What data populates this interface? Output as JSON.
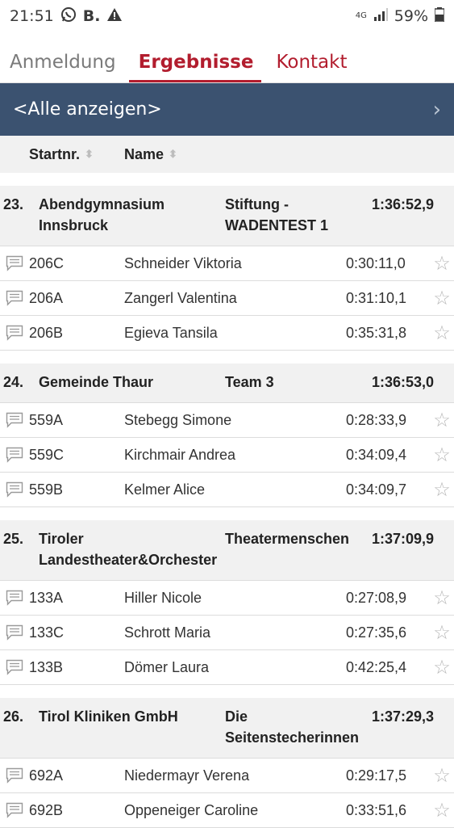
{
  "status": {
    "time": "21:51",
    "app_letter": "B.",
    "network": "4G",
    "battery": "59%"
  },
  "tabs": [
    {
      "label": "Anmeldung"
    },
    {
      "label": "Ergebnisse"
    },
    {
      "label": "Kontakt"
    }
  ],
  "filter": {
    "label": "<Alle anzeigen>",
    "chevron": "›"
  },
  "columns": {
    "startnr": "Startnr.",
    "name": "Name",
    "sort_icon": "⬍"
  },
  "teams": [
    {
      "rank": "23.",
      "name": "Abendgymnasium Innsbruck",
      "category": "Stiftung - WADENTEST 1",
      "time": "1:36:52,9",
      "members": [
        {
          "startnr": "206C",
          "name": "Schneider Viktoria",
          "time": "0:30:11,0"
        },
        {
          "startnr": "206A",
          "name": "Zangerl Valentina",
          "time": "0:31:10,1"
        },
        {
          "startnr": "206B",
          "name": "Egieva Tansila",
          "time": "0:35:31,8"
        }
      ]
    },
    {
      "rank": "24.",
      "name": "Gemeinde Thaur",
      "category": "Team 3",
      "time": "1:36:53,0",
      "members": [
        {
          "startnr": "559A",
          "name": "Stebegg Simone",
          "time": "0:28:33,9"
        },
        {
          "startnr": "559C",
          "name": "Kirchmair Andrea",
          "time": "0:34:09,4"
        },
        {
          "startnr": "559B",
          "name": "Kelmer Alice",
          "time": "0:34:09,7"
        }
      ]
    },
    {
      "rank": "25.",
      "name": "Tiroler Landestheater&Orchester",
      "category": "Theatermenschen",
      "time": "1:37:09,9",
      "members": [
        {
          "startnr": "133A",
          "name": "Hiller Nicole",
          "time": "0:27:08,9"
        },
        {
          "startnr": "133C",
          "name": "Schrott Maria",
          "time": "0:27:35,6"
        },
        {
          "startnr": "133B",
          "name": "Dömer Laura",
          "time": "0:42:25,4"
        }
      ]
    },
    {
      "rank": "26.",
      "name": "Tirol Kliniken GmbH",
      "category": "Die Seitenstecherinnen",
      "time": "1:37:29,3",
      "members": [
        {
          "startnr": "692A",
          "name": "Niedermayr Verena",
          "time": "0:29:17,5"
        },
        {
          "startnr": "692B",
          "name": "Oppeneiger Caroline",
          "time": "0:33:51,6"
        }
      ]
    }
  ],
  "icons": {
    "comment": "comment-icon",
    "star": "☆"
  },
  "colors": {
    "accent": "#b21d2e",
    "filter_bg": "#3b5270"
  }
}
